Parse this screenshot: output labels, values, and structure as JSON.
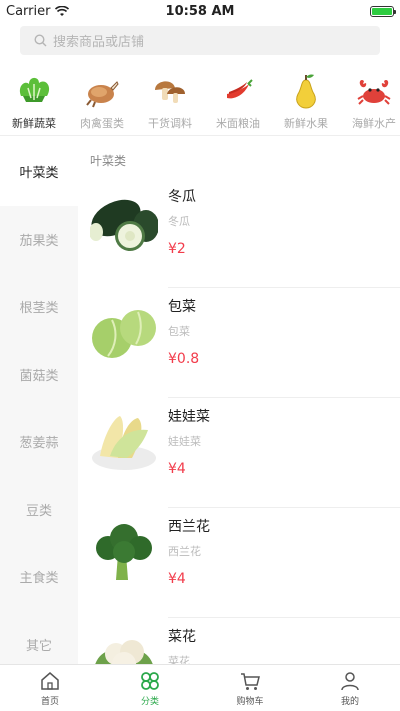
{
  "status": {
    "carrier": "Carrier",
    "time": "10:58 AM",
    "battery_level": 1.0
  },
  "search": {
    "placeholder": "搜索商品或店铺"
  },
  "categories": [
    {
      "label": "新鲜蔬菜",
      "icon": "lettuce-icon",
      "active": true
    },
    {
      "label": "肉禽蛋类",
      "icon": "chicken-icon"
    },
    {
      "label": "干货调料",
      "icon": "mushroom-icon"
    },
    {
      "label": "米面粮油",
      "icon": "chili-icon"
    },
    {
      "label": "新鲜水果",
      "icon": "pear-icon"
    },
    {
      "label": "海鲜水产",
      "icon": "crab-icon"
    }
  ],
  "sidebar": [
    {
      "label": "叶菜类",
      "active": true
    },
    {
      "label": "茄果类"
    },
    {
      "label": "根茎类"
    },
    {
      "label": "菌菇类"
    },
    {
      "label": "葱姜蒜"
    },
    {
      "label": "豆类"
    },
    {
      "label": "主食类"
    },
    {
      "label": "其它"
    }
  ],
  "section_title": "叶菜类",
  "products": [
    {
      "name": "冬瓜",
      "subtitle": "冬瓜",
      "price": "¥2",
      "icon": "wax-gourd-image"
    },
    {
      "name": "包菜",
      "subtitle": "包菜",
      "price": "¥0.8",
      "icon": "cabbage-image"
    },
    {
      "name": "娃娃菜",
      "subtitle": "娃娃菜",
      "price": "¥4",
      "icon": "baby-cabbage-image"
    },
    {
      "name": "西兰花",
      "subtitle": "西兰花",
      "price": "¥4",
      "icon": "broccoli-image"
    },
    {
      "name": "菜花",
      "subtitle": "菜花",
      "price": "",
      "icon": "cauliflower-image"
    }
  ],
  "tabbar": [
    {
      "label": "首页",
      "icon": "home-icon"
    },
    {
      "label": "分类",
      "icon": "category-icon",
      "active": true
    },
    {
      "label": "购物车",
      "icon": "cart-icon"
    },
    {
      "label": "我的",
      "icon": "user-icon"
    }
  ],
  "colors": {
    "accent": "#2aa84a",
    "price": "#f23c4b"
  }
}
